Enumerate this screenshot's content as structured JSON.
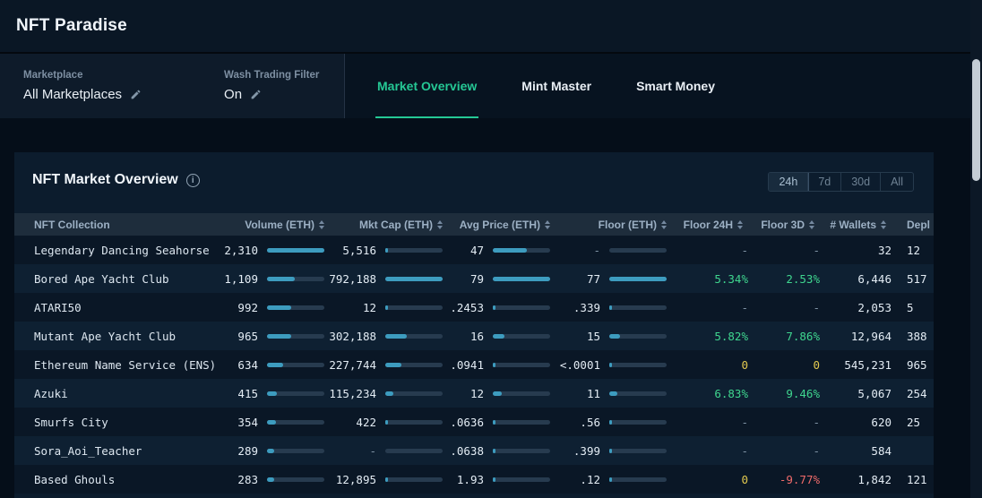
{
  "app": {
    "title": "NFT Paradise"
  },
  "filters": {
    "marketplace": {
      "label": "Marketplace",
      "value": "All Marketplaces"
    },
    "wash_trading": {
      "label": "Wash Trading Filter",
      "value": "On"
    }
  },
  "tabs": [
    {
      "id": "market-overview",
      "label": "Market Overview",
      "active": true
    },
    {
      "id": "mint-master",
      "label": "Mint Master",
      "active": false
    },
    {
      "id": "smart-money",
      "label": "Smart Money",
      "active": false
    }
  ],
  "panel": {
    "title": "NFT Market Overview",
    "time_ranges": [
      {
        "label": "24h",
        "active": true
      },
      {
        "label": "7d",
        "active": false
      },
      {
        "label": "30d",
        "active": false
      },
      {
        "label": "All",
        "active": false
      }
    ]
  },
  "table": {
    "columns": [
      {
        "label": "NFT Collection",
        "sortable": false,
        "type": "name"
      },
      {
        "label": "Volume (ETH)",
        "sortable": true,
        "type": "bar",
        "key": "volume"
      },
      {
        "label": "Mkt Cap (ETH)",
        "sortable": true,
        "type": "bar",
        "key": "mkt_cap"
      },
      {
        "label": "Avg Price (ETH)",
        "sortable": true,
        "type": "bar",
        "key": "avg_price"
      },
      {
        "label": "Floor (ETH)",
        "sortable": true,
        "type": "bar",
        "key": "floor"
      },
      {
        "label": "Floor 24H",
        "sortable": true,
        "type": "plain",
        "key": "floor_24h"
      },
      {
        "label": "Floor 3D",
        "sortable": true,
        "type": "plain",
        "key": "floor_3d"
      },
      {
        "label": "# Wallets",
        "sortable": true,
        "type": "plain",
        "key": "wallets"
      },
      {
        "label": "Depl",
        "sortable": true,
        "type": "plain",
        "key": "depl"
      }
    ],
    "rows": [
      {
        "name": "Legendary Dancing Seahorse",
        "volume": {
          "text": "2,310",
          "value": 2310
        },
        "mkt_cap": {
          "text": "5,516",
          "value": 5516
        },
        "avg_price": {
          "text": "47",
          "value": 47
        },
        "floor": {
          "text": "-",
          "value": null
        },
        "floor_24h": {
          "text": "-",
          "tone": "muted"
        },
        "floor_3d": {
          "text": "-",
          "tone": "muted"
        },
        "wallets": "32",
        "depl": "12"
      },
      {
        "name": "Bored Ape Yacht Club",
        "volume": {
          "text": "1,109",
          "value": 1109
        },
        "mkt_cap": {
          "text": "792,188",
          "value": 792188
        },
        "avg_price": {
          "text": "79",
          "value": 79
        },
        "floor": {
          "text": "77",
          "value": 77
        },
        "floor_24h": {
          "text": "5.34%",
          "tone": "pos"
        },
        "floor_3d": {
          "text": "2.53%",
          "tone": "pos"
        },
        "wallets": "6,446",
        "depl": "517"
      },
      {
        "name": "ATARI50",
        "volume": {
          "text": "992",
          "value": 992
        },
        "mkt_cap": {
          "text": "12",
          "value": 12
        },
        "avg_price": {
          "text": ".2453",
          "value": 0.2453
        },
        "floor": {
          "text": ".339",
          "value": 0.339
        },
        "floor_24h": {
          "text": "-",
          "tone": "muted"
        },
        "floor_3d": {
          "text": "-",
          "tone": "muted"
        },
        "wallets": "2,053",
        "depl": "5"
      },
      {
        "name": "Mutant Ape Yacht Club",
        "volume": {
          "text": "965",
          "value": 965
        },
        "mkt_cap": {
          "text": "302,188",
          "value": 302188
        },
        "avg_price": {
          "text": "16",
          "value": 16
        },
        "floor": {
          "text": "15",
          "value": 15
        },
        "floor_24h": {
          "text": "5.82%",
          "tone": "pos"
        },
        "floor_3d": {
          "text": "7.86%",
          "tone": "pos"
        },
        "wallets": "12,964",
        "depl": "388"
      },
      {
        "name": "Ethereum Name Service (ENS)",
        "volume": {
          "text": "634",
          "value": 634
        },
        "mkt_cap": {
          "text": "227,744",
          "value": 227744
        },
        "avg_price": {
          "text": ".0941",
          "value": 0.0941
        },
        "floor": {
          "text": "<.0001",
          "value": 0.0001
        },
        "floor_24h": {
          "text": "0",
          "tone": "zero"
        },
        "floor_3d": {
          "text": "0",
          "tone": "zero"
        },
        "wallets": "545,231",
        "depl": "965"
      },
      {
        "name": "Azuki",
        "volume": {
          "text": "415",
          "value": 415
        },
        "mkt_cap": {
          "text": "115,234",
          "value": 115234
        },
        "avg_price": {
          "text": "12",
          "value": 12
        },
        "floor": {
          "text": "11",
          "value": 11
        },
        "floor_24h": {
          "text": "6.83%",
          "tone": "pos"
        },
        "floor_3d": {
          "text": "9.46%",
          "tone": "pos"
        },
        "wallets": "5,067",
        "depl": "254"
      },
      {
        "name": "Smurfs City",
        "volume": {
          "text": "354",
          "value": 354
        },
        "mkt_cap": {
          "text": "422",
          "value": 422
        },
        "avg_price": {
          "text": ".0636",
          "value": 0.0636
        },
        "floor": {
          "text": ".56",
          "value": 0.56
        },
        "floor_24h": {
          "text": "-",
          "tone": "muted"
        },
        "floor_3d": {
          "text": "-",
          "tone": "muted"
        },
        "wallets": "620",
        "depl": "25"
      },
      {
        "name": "Sora_Aoi_Teacher",
        "volume": {
          "text": "289",
          "value": 289
        },
        "mkt_cap": {
          "text": "-",
          "value": null
        },
        "avg_price": {
          "text": ".0638",
          "value": 0.0638
        },
        "floor": {
          "text": ".399",
          "value": 0.399
        },
        "floor_24h": {
          "text": "-",
          "tone": "muted"
        },
        "floor_3d": {
          "text": "-",
          "tone": "muted"
        },
        "wallets": "584",
        "depl": ""
      },
      {
        "name": "Based Ghouls",
        "volume": {
          "text": "283",
          "value": 283
        },
        "mkt_cap": {
          "text": "12,895",
          "value": 12895
        },
        "avg_price": {
          "text": "1.93",
          "value": 1.93
        },
        "floor": {
          "text": ".12",
          "value": 0.12
        },
        "floor_24h": {
          "text": "0",
          "tone": "zero"
        },
        "floor_3d": {
          "text": "-9.77%",
          "tone": "neg"
        },
        "wallets": "1,842",
        "depl": "121"
      }
    ]
  },
  "theme": {
    "accent": "#25c895",
    "positive": "#3fd68f",
    "negative": "#ef6a6a",
    "zero": "#e2c94f",
    "bar_fill": "#3d9cbf"
  }
}
